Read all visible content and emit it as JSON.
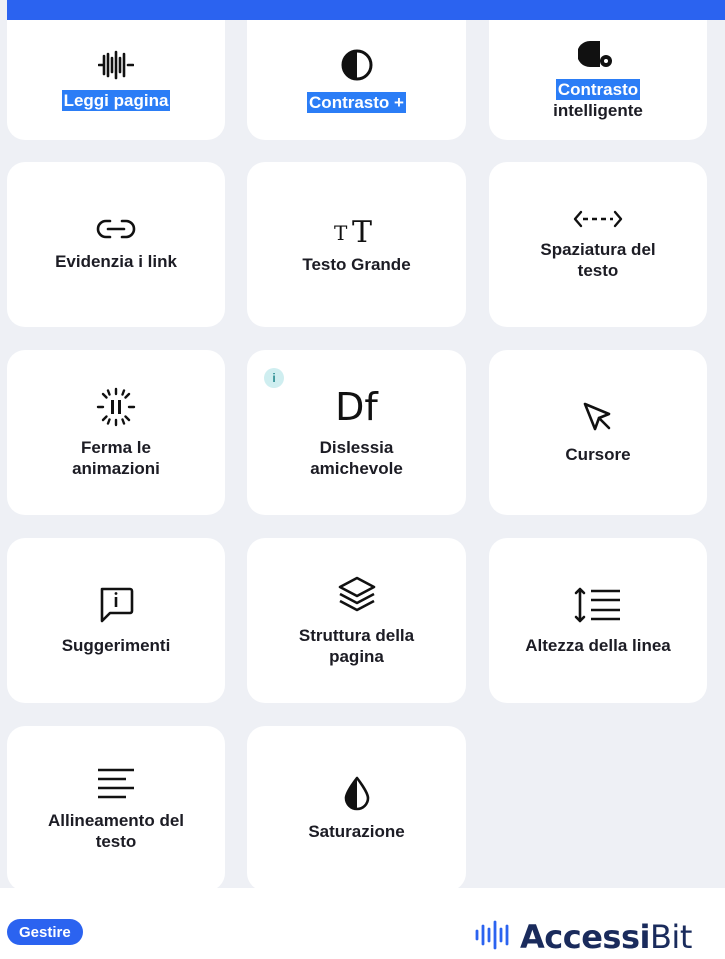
{
  "cards": {
    "leggi_pagina": "Leggi pagina",
    "contrasto_plus": "Contrasto +",
    "contrasto_intelligente_1": "Contrasto",
    "contrasto_intelligente_2": "intelligente",
    "evidenzia_link": "Evidenzia i link",
    "testo_grande": "Testo Grande",
    "spaziatura_1": "Spaziatura del",
    "spaziatura_2": "testo",
    "ferma_1": "Ferma le",
    "ferma_2": "animazioni",
    "dislessia_1": "Dislessia",
    "dislessia_2": "amichevole",
    "cursore": "Cursore",
    "suggerimenti": "Suggerimenti",
    "struttura_1": "Struttura della",
    "struttura_2": "pagina",
    "altezza": "Altezza della linea",
    "allineamento_1": "Allineamento del",
    "allineamento_2": "testo",
    "saturazione": "Saturazione"
  },
  "dislessia_icon_text": "Df",
  "testo_grande_icon_text": "TT",
  "info_badge": "i",
  "footer": {
    "manage_button": "Gestire",
    "brand_bold": "Accessi",
    "brand_light": "Bit"
  },
  "colors": {
    "accent": "#2b63f0",
    "highlight": "#2b7df6",
    "background": "#eef0f5"
  }
}
